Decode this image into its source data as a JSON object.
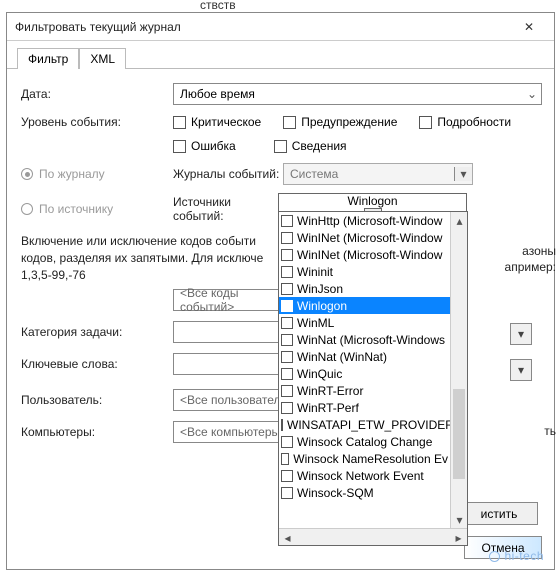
{
  "truncated_above": "ствств",
  "title": "Фильтровать текущий журнал",
  "tabs": {
    "filter": "Фильтр",
    "xml": "XML"
  },
  "labels": {
    "date": "Дата:",
    "level": "Уровень события:",
    "by_log": "По журналу",
    "by_source": "По источнику",
    "journals": "Журналы событий:",
    "sources": "Источники событий:",
    "codes_desc_1": "Включение или исключение кодов событи",
    "codes_desc_2": "кодов, разделяя их запятыми. Для исключе",
    "codes_desc_3": "1,3,5-99,-76",
    "codes_desc_right_1": "азоны",
    "codes_desc_right_2": "апример:",
    "task_cat": "Категория задачи:",
    "keywords": "Ключевые слова:",
    "user": "Пользователь:",
    "computers": "Компьютеры:",
    "right_frag": "ть"
  },
  "values": {
    "date": "Любое время",
    "journals": "Система",
    "sources": "Winlogon",
    "codes": "<Все коды событий>",
    "user": "<Все пользователи>",
    "computers": "<Все компьютеры>"
  },
  "checks": {
    "critical": "Критическое",
    "warning": "Предупреждение",
    "verbose": "Подробности",
    "error": "Ошибка",
    "info": "Сведения"
  },
  "buttons": {
    "clear": "истить",
    "cancel": "Отмена"
  },
  "dropdown_items": [
    {
      "label": "WinHttp (Microsoft-Window",
      "checked": false
    },
    {
      "label": "WinINet (Microsoft-Window",
      "checked": false
    },
    {
      "label": "WinINet (Microsoft-Window",
      "checked": false
    },
    {
      "label": "Wininit",
      "checked": false
    },
    {
      "label": "WinJson",
      "checked": false
    },
    {
      "label": "Winlogon",
      "checked": true,
      "selected": true
    },
    {
      "label": "WinML",
      "checked": false
    },
    {
      "label": "WinNat (Microsoft-Windows",
      "checked": false
    },
    {
      "label": "WinNat (WinNat)",
      "checked": false
    },
    {
      "label": "WinQuic",
      "checked": false
    },
    {
      "label": "WinRT-Error",
      "checked": false
    },
    {
      "label": "WinRT-Perf",
      "checked": false
    },
    {
      "label": "WINSATAPI_ETW_PROVIDER",
      "checked": false
    },
    {
      "label": "Winsock Catalog Change",
      "checked": false
    },
    {
      "label": "Winsock NameResolution Ev",
      "checked": false
    },
    {
      "label": "Winsock Network Event",
      "checked": false
    },
    {
      "label": "Winsock-SQM",
      "checked": false
    }
  ],
  "watermark": "hi-tech"
}
